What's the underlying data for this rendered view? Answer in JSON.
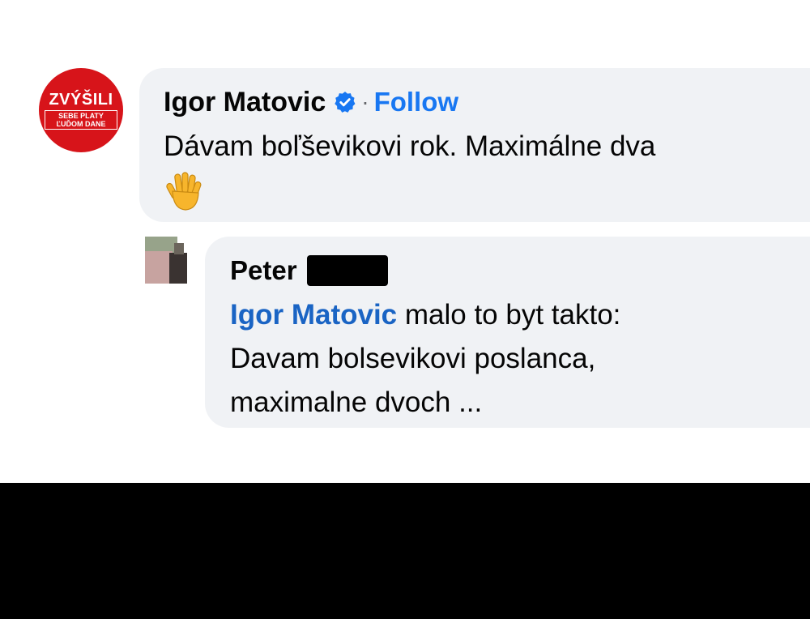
{
  "comment": {
    "avatar": {
      "line1": "ZVÝŠILI",
      "line2": "SEBE PLATY ĽUĎOM DANE",
      "color": "#d7141a"
    },
    "author": "Igor Matovic",
    "verified_icon": "verified-badge-icon",
    "separator": "·",
    "follow_label": "Follow",
    "text": "Dávam boľševikovi rok. Maximálne dva",
    "emoji": "raised-hand-emoji"
  },
  "reply": {
    "author": "Peter",
    "mention": "Igor Matovic",
    "line1_rest": " malo to byt takto:",
    "line2": "Davam bolsevikovi poslanca,",
    "line3": "maximalne dvoch ..."
  },
  "colors": {
    "bubble": "#f0f2f5",
    "link_blue": "#1877f2",
    "mention_blue": "#1a64c4",
    "text": "#050505"
  }
}
